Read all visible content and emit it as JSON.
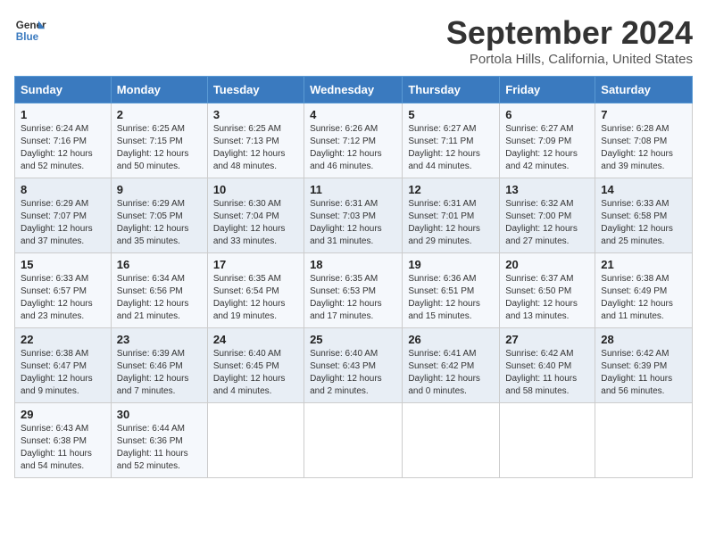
{
  "header": {
    "logo_line1": "General",
    "logo_line2": "Blue",
    "month_year": "September 2024",
    "location": "Portola Hills, California, United States"
  },
  "weekdays": [
    "Sunday",
    "Monday",
    "Tuesday",
    "Wednesday",
    "Thursday",
    "Friday",
    "Saturday"
  ],
  "weeks": [
    [
      {
        "day": 1,
        "sunrise": "6:24 AM",
        "sunset": "7:16 PM",
        "daylight": "12 hours and 52 minutes."
      },
      {
        "day": 2,
        "sunrise": "6:25 AM",
        "sunset": "7:15 PM",
        "daylight": "12 hours and 50 minutes."
      },
      {
        "day": 3,
        "sunrise": "6:25 AM",
        "sunset": "7:13 PM",
        "daylight": "12 hours and 48 minutes."
      },
      {
        "day": 4,
        "sunrise": "6:26 AM",
        "sunset": "7:12 PM",
        "daylight": "12 hours and 46 minutes."
      },
      {
        "day": 5,
        "sunrise": "6:27 AM",
        "sunset": "7:11 PM",
        "daylight": "12 hours and 44 minutes."
      },
      {
        "day": 6,
        "sunrise": "6:27 AM",
        "sunset": "7:09 PM",
        "daylight": "12 hours and 42 minutes."
      },
      {
        "day": 7,
        "sunrise": "6:28 AM",
        "sunset": "7:08 PM",
        "daylight": "12 hours and 39 minutes."
      }
    ],
    [
      {
        "day": 8,
        "sunrise": "6:29 AM",
        "sunset": "7:07 PM",
        "daylight": "12 hours and 37 minutes."
      },
      {
        "day": 9,
        "sunrise": "6:29 AM",
        "sunset": "7:05 PM",
        "daylight": "12 hours and 35 minutes."
      },
      {
        "day": 10,
        "sunrise": "6:30 AM",
        "sunset": "7:04 PM",
        "daylight": "12 hours and 33 minutes."
      },
      {
        "day": 11,
        "sunrise": "6:31 AM",
        "sunset": "7:03 PM",
        "daylight": "12 hours and 31 minutes."
      },
      {
        "day": 12,
        "sunrise": "6:31 AM",
        "sunset": "7:01 PM",
        "daylight": "12 hours and 29 minutes."
      },
      {
        "day": 13,
        "sunrise": "6:32 AM",
        "sunset": "7:00 PM",
        "daylight": "12 hours and 27 minutes."
      },
      {
        "day": 14,
        "sunrise": "6:33 AM",
        "sunset": "6:58 PM",
        "daylight": "12 hours and 25 minutes."
      }
    ],
    [
      {
        "day": 15,
        "sunrise": "6:33 AM",
        "sunset": "6:57 PM",
        "daylight": "12 hours and 23 minutes."
      },
      {
        "day": 16,
        "sunrise": "6:34 AM",
        "sunset": "6:56 PM",
        "daylight": "12 hours and 21 minutes."
      },
      {
        "day": 17,
        "sunrise": "6:35 AM",
        "sunset": "6:54 PM",
        "daylight": "12 hours and 19 minutes."
      },
      {
        "day": 18,
        "sunrise": "6:35 AM",
        "sunset": "6:53 PM",
        "daylight": "12 hours and 17 minutes."
      },
      {
        "day": 19,
        "sunrise": "6:36 AM",
        "sunset": "6:51 PM",
        "daylight": "12 hours and 15 minutes."
      },
      {
        "day": 20,
        "sunrise": "6:37 AM",
        "sunset": "6:50 PM",
        "daylight": "12 hours and 13 minutes."
      },
      {
        "day": 21,
        "sunrise": "6:38 AM",
        "sunset": "6:49 PM",
        "daylight": "12 hours and 11 minutes."
      }
    ],
    [
      {
        "day": 22,
        "sunrise": "6:38 AM",
        "sunset": "6:47 PM",
        "daylight": "12 hours and 9 minutes."
      },
      {
        "day": 23,
        "sunrise": "6:39 AM",
        "sunset": "6:46 PM",
        "daylight": "12 hours and 7 minutes."
      },
      {
        "day": 24,
        "sunrise": "6:40 AM",
        "sunset": "6:45 PM",
        "daylight": "12 hours and 4 minutes."
      },
      {
        "day": 25,
        "sunrise": "6:40 AM",
        "sunset": "6:43 PM",
        "daylight": "12 hours and 2 minutes."
      },
      {
        "day": 26,
        "sunrise": "6:41 AM",
        "sunset": "6:42 PM",
        "daylight": "12 hours and 0 minutes."
      },
      {
        "day": 27,
        "sunrise": "6:42 AM",
        "sunset": "6:40 PM",
        "daylight": "11 hours and 58 minutes."
      },
      {
        "day": 28,
        "sunrise": "6:42 AM",
        "sunset": "6:39 PM",
        "daylight": "11 hours and 56 minutes."
      }
    ],
    [
      {
        "day": 29,
        "sunrise": "6:43 AM",
        "sunset": "6:38 PM",
        "daylight": "11 hours and 54 minutes."
      },
      {
        "day": 30,
        "sunrise": "6:44 AM",
        "sunset": "6:36 PM",
        "daylight": "11 hours and 52 minutes."
      },
      null,
      null,
      null,
      null,
      null
    ]
  ]
}
